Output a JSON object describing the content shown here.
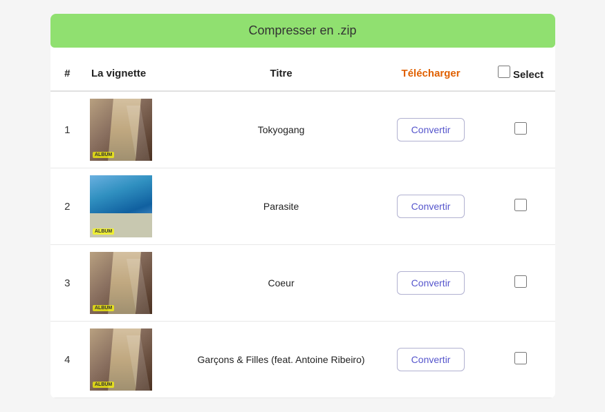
{
  "compress_button": {
    "label": "Compresser en .zip"
  },
  "table": {
    "headers": {
      "num": "#",
      "thumbnail": "La vignette",
      "title": "Titre",
      "download": "Télécharger",
      "select": "Select"
    },
    "rows": [
      {
        "num": 1,
        "title": "Tokyogang",
        "thumb_type": "building",
        "convertir_label": "Convertir"
      },
      {
        "num": 2,
        "title": "Parasite",
        "thumb_type": "blue",
        "convertir_label": "Convertir"
      },
      {
        "num": 3,
        "title": "Coeur",
        "thumb_type": "building",
        "convertir_label": "Convertir"
      },
      {
        "num": 4,
        "title": "Garçons & Filles (feat. Antoine Ribeiro)",
        "thumb_type": "building2",
        "convertir_label": "Convertir"
      }
    ]
  }
}
